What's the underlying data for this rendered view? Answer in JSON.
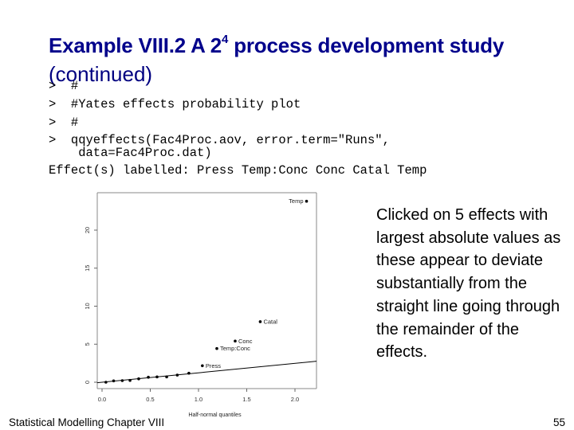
{
  "slide": {
    "title_main": "Example VIII.2 A 2",
    "title_superscript": "4",
    "title_rest": " process development study",
    "title_line2": "(continued)",
    "code_lines": [
      ">  #",
      ">  #Yates effects probability plot",
      ">  #",
      ">  qqyeffects(Fac4Proc.aov, error.term=\"Runs\",",
      "    data=Fac4Proc.dat)",
      "Effect(s) labelled: Press Temp:Conc Conc Catal Temp"
    ],
    "side_note": "Clicked on 5 effects with largest absolute values as these appear to deviate substantially from the straight line going through the remainder of the effects.",
    "footer_left": "Statistical Modelling   Chapter VIII",
    "page_number": "55",
    "colors": {
      "title": "#00008b",
      "text": "#000000",
      "points": "#000000"
    }
  },
  "chart_data": {
    "type": "scatter",
    "title": "",
    "xlabel": "Half-normal quantiles",
    "ylabel": "",
    "xlim": [
      -0.05,
      2.25
    ],
    "ylim": [
      -1.0,
      25.0
    ],
    "x_ticks": [
      0.0,
      0.5,
      1.0,
      1.5,
      2.0
    ],
    "x_tick_labels": [
      "0.0",
      "0.5",
      "1.0",
      "1.5",
      "2.0"
    ],
    "y_ticks": [
      0,
      5,
      10,
      15,
      20
    ],
    "y_tick_labels": [
      "0",
      "5",
      "10",
      "15",
      "20"
    ],
    "grid": false,
    "points": [
      {
        "x": 0.04,
        "y": 0.0,
        "label": ""
      },
      {
        "x": 0.12,
        "y": 0.18,
        "label": ""
      },
      {
        "x": 0.21,
        "y": 0.21,
        "label": ""
      },
      {
        "x": 0.29,
        "y": 0.24,
        "label": ""
      },
      {
        "x": 0.38,
        "y": 0.45,
        "label": ""
      },
      {
        "x": 0.48,
        "y": 0.66,
        "label": ""
      },
      {
        "x": 0.57,
        "y": 0.7,
        "label": ""
      },
      {
        "x": 0.67,
        "y": 0.7,
        "label": ""
      },
      {
        "x": 0.78,
        "y": 0.94,
        "label": ""
      },
      {
        "x": 0.9,
        "y": 1.18,
        "label": ""
      },
      {
        "x": 1.04,
        "y": 2.17,
        "label": "Press",
        "label_side": "right"
      },
      {
        "x": 1.19,
        "y": 4.43,
        "label": "Temp:Conc",
        "label_side": "right"
      },
      {
        "x": 1.38,
        "y": 5.41,
        "label": "Conc",
        "label_side": "right"
      },
      {
        "x": 1.64,
        "y": 7.96,
        "label": "Catal",
        "label_side": "right"
      },
      {
        "x": 2.12,
        "y": 23.8,
        "label": "Temp",
        "label_side": "left"
      }
    ],
    "reference_line": {
      "intercept": 0.0,
      "slope": 1.24
    }
  }
}
